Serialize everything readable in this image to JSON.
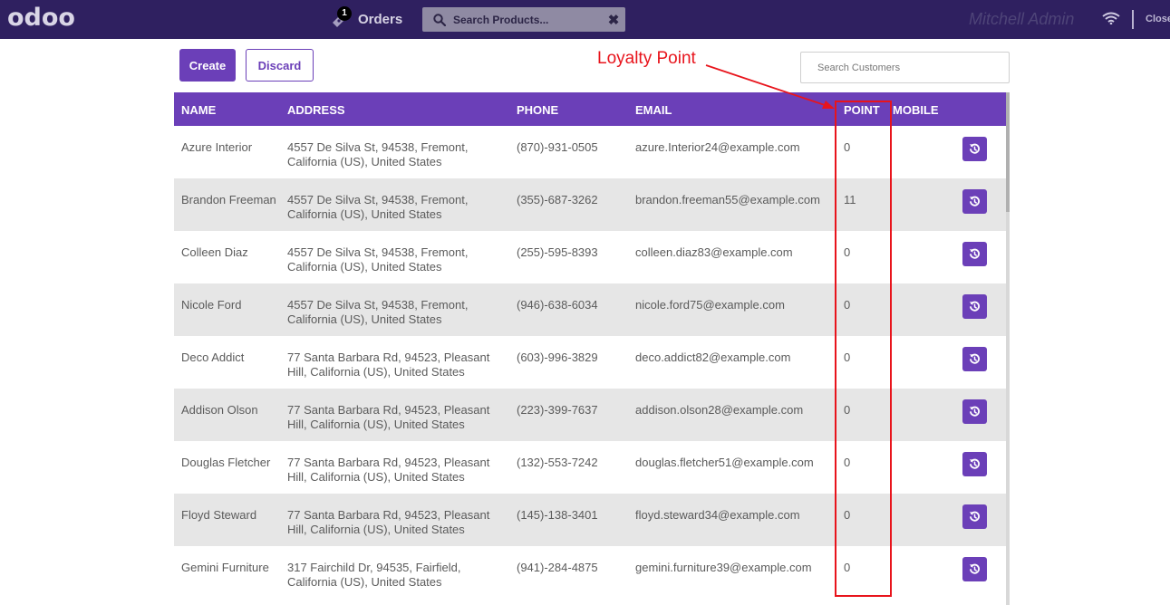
{
  "header": {
    "logo": "odoo",
    "orders_label": "Orders",
    "orders_count": "1",
    "search_placeholder": "Search Products...",
    "cashier": "Mitchell Admin",
    "close_label": "Close"
  },
  "toolbar": {
    "create_label": "Create",
    "discard_label": "Discard",
    "search_customers_placeholder": "Search Customers"
  },
  "annotation": {
    "label": "Loyalty Point",
    "color": "#e8141c"
  },
  "colors": {
    "topbar": "#2f2060",
    "accent": "#6b3fb8",
    "row_alt": "#e6e6e6"
  },
  "table": {
    "columns": [
      "NAME",
      "ADDRESS",
      "PHONE",
      "EMAIL",
      "POINT",
      "MOBILE"
    ],
    "rows": [
      {
        "name": "Azure Interior",
        "address": "4557 De Silva St, 94538, Fremont, California (US), United States",
        "phone": "(870)-931-0505",
        "email": "azure.Interior24@example.com",
        "point": "0"
      },
      {
        "name": "Brandon Freeman",
        "address": "4557 De Silva St, 94538, Fremont, California (US), United States",
        "phone": "(355)-687-3262",
        "email": "brandon.freeman55@example.com",
        "point": "11"
      },
      {
        "name": "Colleen Diaz",
        "address": "4557 De Silva St, 94538, Fremont, California (US), United States",
        "phone": "(255)-595-8393",
        "email": "colleen.diaz83@example.com",
        "point": "0"
      },
      {
        "name": "Nicole Ford",
        "address": "4557 De Silva St, 94538, Fremont, California (US), United States",
        "phone": "(946)-638-6034",
        "email": "nicole.ford75@example.com",
        "point": "0"
      },
      {
        "name": "Deco Addict",
        "address": "77 Santa Barbara Rd, 94523, Pleasant Hill, California (US), United States",
        "phone": "(603)-996-3829",
        "email": "deco.addict82@example.com",
        "point": "0"
      },
      {
        "name": "Addison Olson",
        "address": "77 Santa Barbara Rd, 94523, Pleasant Hill, California (US), United States",
        "phone": "(223)-399-7637",
        "email": "addison.olson28@example.com",
        "point": "0"
      },
      {
        "name": "Douglas Fletcher",
        "address": "77 Santa Barbara Rd, 94523, Pleasant Hill, California (US), United States",
        "phone": "(132)-553-7242",
        "email": "douglas.fletcher51@example.com",
        "point": "0"
      },
      {
        "name": "Floyd Steward",
        "address": "77 Santa Barbara Rd, 94523, Pleasant Hill, California (US), United States",
        "phone": "(145)-138-3401",
        "email": "floyd.steward34@example.com",
        "point": "0"
      },
      {
        "name": "Gemini Furniture",
        "address": "317 Fairchild Dr, 94535, Fairfield, California (US), United States",
        "phone": "(941)-284-4875",
        "email": "gemini.furniture39@example.com",
        "point": "0"
      }
    ]
  }
}
